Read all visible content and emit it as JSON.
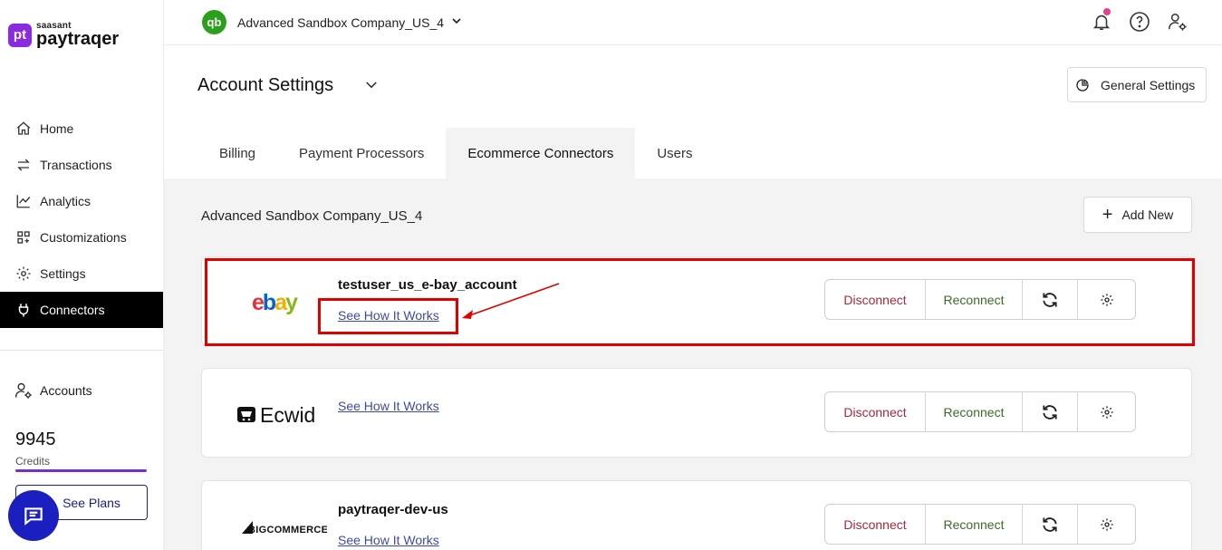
{
  "brand": {
    "small": "saasant",
    "big": "paytraqer",
    "badge": "pt"
  },
  "sidebar": {
    "items": [
      {
        "label": "Home",
        "icon": "home-icon"
      },
      {
        "label": "Transactions",
        "icon": "swap-arrows-icon"
      },
      {
        "label": "Analytics",
        "icon": "line-chart-icon"
      },
      {
        "label": "Customizations",
        "icon": "grid-plus-icon"
      },
      {
        "label": "Settings",
        "icon": "gear-icon"
      },
      {
        "label": "Connectors",
        "icon": "plug-icon",
        "active": true
      }
    ],
    "accounts_label": "Accounts",
    "credits_value": "9945",
    "credits_label": "Credits",
    "see_plans_label": "See Plans"
  },
  "topbar": {
    "company": "Advanced Sandbox Company_US_4",
    "qb_logo": "qb"
  },
  "header": {
    "title": "Account Settings",
    "general_settings_label": "General Settings"
  },
  "tabs": [
    {
      "label": "Billing"
    },
    {
      "label": "Payment Processors"
    },
    {
      "label": "Ecommerce Connectors",
      "active": true
    },
    {
      "label": "Users"
    }
  ],
  "main": {
    "company": "Advanced Sandbox Company_US_4",
    "add_new_label": "Add New",
    "connectors": [
      {
        "logo": "ebay",
        "logo_text": "ebay",
        "name": "testuser_us_e-bay_account",
        "link": "See How It Works",
        "disconnect": "Disconnect",
        "reconnect": "Reconnect"
      },
      {
        "logo": "ecwid",
        "logo_text": "Ecwid",
        "name": "",
        "link": "See How It Works",
        "disconnect": "Disconnect",
        "reconnect": "Reconnect"
      },
      {
        "logo": "bigcommerce",
        "logo_text": "BIGCOMMERCE",
        "name": "paytraqer-dev-us",
        "link": "See How It Works",
        "disconnect": "Disconnect",
        "reconnect": "Reconnect"
      }
    ]
  },
  "colors": {
    "accent": "#7b2fbe",
    "highlight": "#e00000",
    "link": "#3d4aa8",
    "disconnect": "#a32a3d",
    "reconnect": "#3d6b2b"
  }
}
